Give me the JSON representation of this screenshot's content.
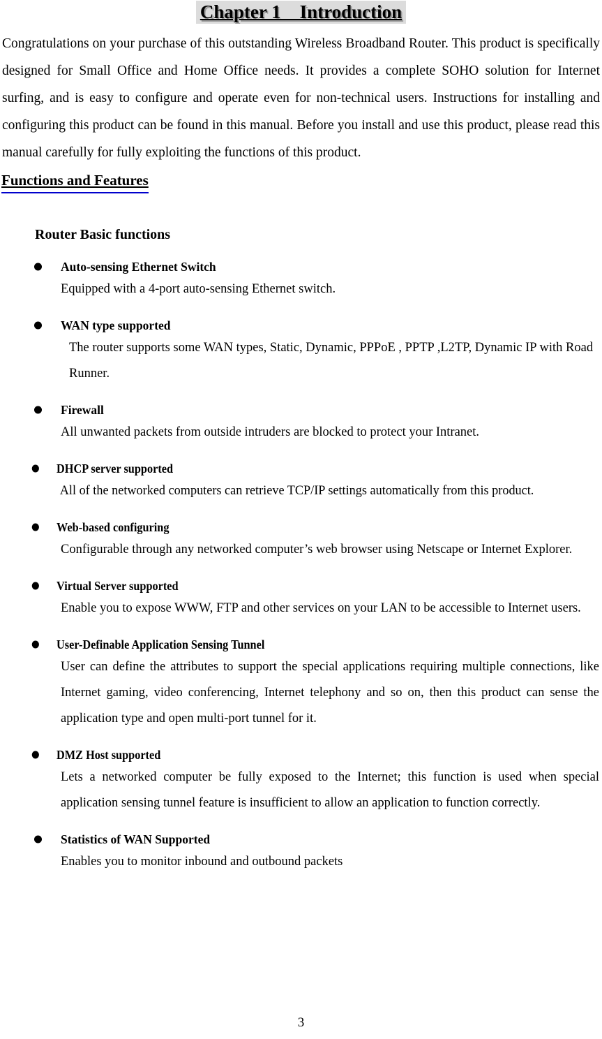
{
  "document": {
    "chapter_title": "Chapter 1    Introduction",
    "page_number": "3",
    "highlight_color": "#dcdcdc",
    "heading_underline_color": "#0000cc"
  },
  "intro": {
    "paragraph": "Congratulations on your purchase of this outstanding Wireless Broadband Router. This product is specifically designed for Small Office and Home Office needs. It provides a complete SOHO solution for Internet surfing, and is easy to configure and operate even for non-technical users. Instructions for installing and configuring this product can be found in this manual. Before you install and use this product, please read this manual carefully for fully exploiting the functions of this product."
  },
  "section": {
    "heading": "Functions and Features",
    "sub_heading": "Router Basic functions"
  },
  "features": [
    {
      "title": "Auto-sensing Ethernet Switch",
      "body": "Equipped with a 4-port auto-sensing Ethernet switch."
    },
    {
      "title": "WAN type supported",
      "body": "The router supports some WAN types, Static, Dynamic, PPPoE , PPTP ,L2TP, Dynamic IP with Road Runner."
    },
    {
      "title": "Firewall",
      "body": "All unwanted packets from outside intruders are blocked to protect your Intranet."
    },
    {
      "title": "DHCP server supported",
      "body": "All of the networked computers can retrieve TCP/IP settings automatically from this product."
    },
    {
      "title": "Web-based configuring",
      "body": "Configurable through any networked computer’s web browser using Netscape or Internet Explorer."
    },
    {
      "title": "Virtual Server supported",
      "body": "Enable you to expose WWW, FTP and other services on your LAN to be accessible to Internet users."
    },
    {
      "title": "User-Definable Application Sensing Tunnel",
      "body": "User can define the attributes to support the special applications requiring multiple connections, like Internet gaming, video conferencing, Internet telephony and so on, then this product can sense the application type and open multi-port tunnel for it."
    },
    {
      "title": "DMZ Host supported",
      "body": "Lets a networked computer be fully exposed to the Internet; this function is used when special application sensing tunnel feature is insufficient to allow an application to function correctly."
    },
    {
      "title": "Statistics of WAN Supported",
      "body": "Enables you to monitor inbound and outbound packets"
    }
  ]
}
